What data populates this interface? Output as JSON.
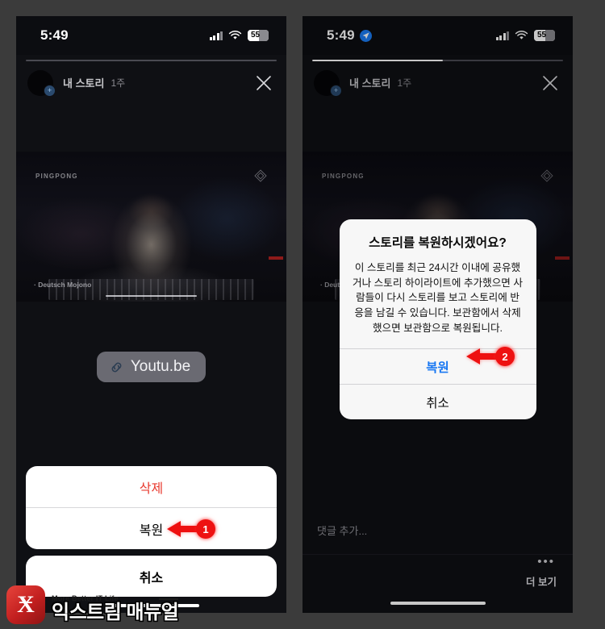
{
  "statusbar": {
    "time": "5:49",
    "battery_percent": "55",
    "icons": {
      "location": "location-arrow-icon",
      "signal": "cellular-signal-icon",
      "wifi": "wifi-icon",
      "battery": "battery-icon"
    }
  },
  "story": {
    "username": "내 스토리",
    "timestamp": "1주",
    "close_label": "✕",
    "progress_left_percent": 0,
    "progress_right_percent": 52
  },
  "media": {
    "watermark_top": "PINGPONG",
    "caption_bottom": "· Deutsch Mojono",
    "diamond_icon": "diamond-logo-icon"
  },
  "link_chip": {
    "label": "Youtu.be",
    "icon": "link-chain-icon"
  },
  "action_sheet": {
    "delete_label": "삭제",
    "restore_label": "복원",
    "cancel_label": "취소"
  },
  "alert": {
    "title": "스토리를 복원하시겠어요?",
    "message": "이 스토리를 최근 24시간 이내에 공유했거나 스토리 하이라이트에 추가했으면 사람들이 다시 스토리를 보고 스토리에 반응을 남길 수 있습니다. 보관함에서 삭제했으면 보관함으로 복원됩니다.",
    "confirm_label": "복원",
    "cancel_label": "취소",
    "confirm_color": "#1877f2"
  },
  "right_bottom": {
    "comment_placeholder": "댓글 추가...",
    "more_dots": "•••",
    "more_label": "더 보기"
  },
  "annotations": {
    "step1": "1",
    "step2": "2",
    "color": "#ee1111"
  },
  "watermark": {
    "logo_letter": "Ӿ",
    "tagline": "More Better IT Life",
    "name": "익스트림 매뉴얼"
  }
}
